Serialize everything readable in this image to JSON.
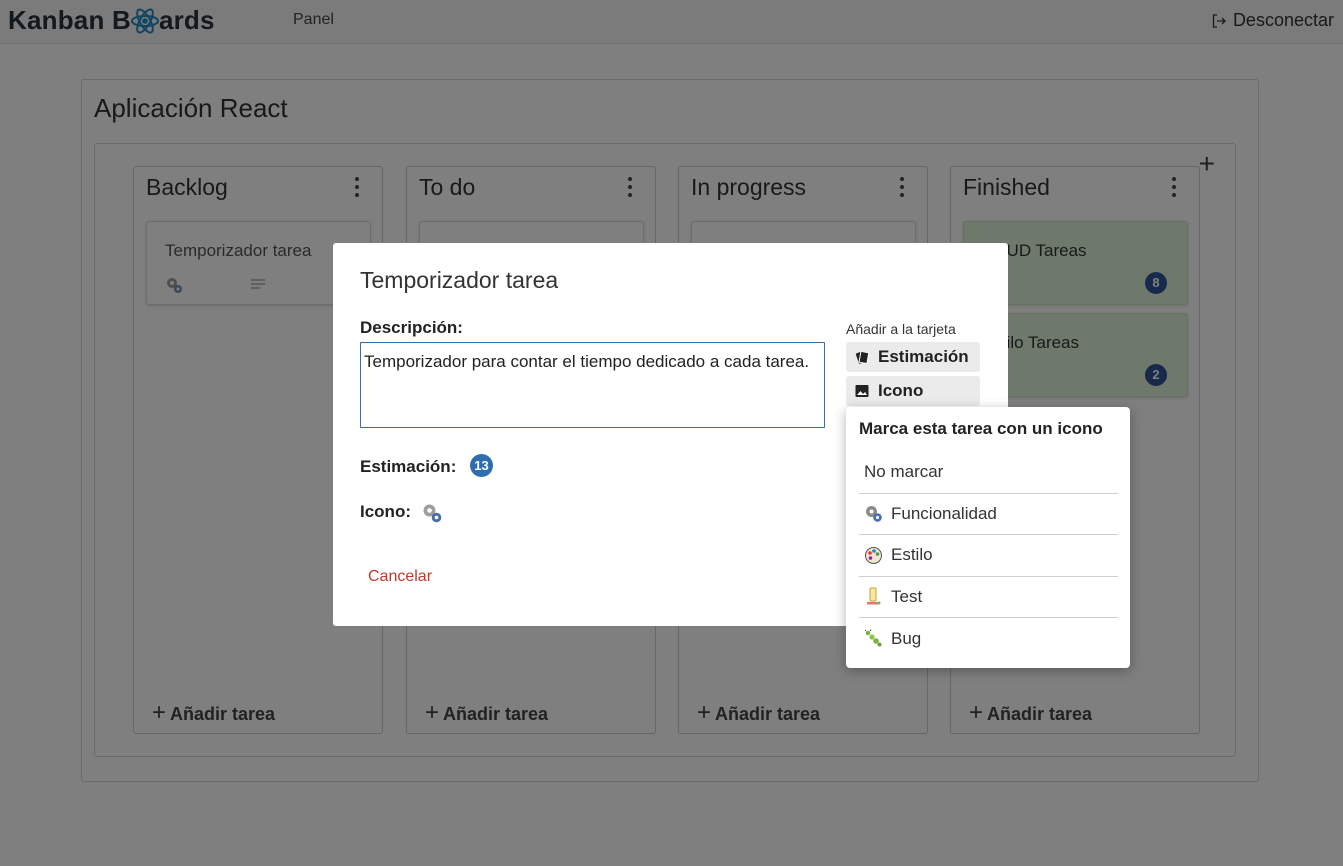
{
  "navbar": {
    "brand_left": "Kanban B",
    "brand_right": "ards",
    "panel_link": "Panel",
    "logout_label": "Desconectar"
  },
  "project": {
    "title": "Aplicación React",
    "add_column_label": "+"
  },
  "columns": [
    {
      "title": "Backlog",
      "add_task_label": "Añadir tarea",
      "cards": [
        {
          "title": "Temporizador tarea"
        }
      ]
    },
    {
      "title": "To do",
      "add_task_label": "Añadir tarea",
      "cards": [
        {
          "title": ""
        }
      ]
    },
    {
      "title": "In progress",
      "add_task_label": "Añadir tarea",
      "cards": [
        {
          "title": ""
        }
      ]
    },
    {
      "title": "Finished",
      "add_task_label": "Añadir tarea",
      "cards": [
        {
          "title": "CRUD Tareas",
          "estimate": "8"
        },
        {
          "title": "Estilo Tareas",
          "estimate": "2"
        }
      ]
    }
  ],
  "modal": {
    "title": "Temporizador tarea",
    "description_label": "Descripción:",
    "description_value": "Temporizador para contar el tiempo dedicado a cada tarea.",
    "estimate_label": "Estimación:",
    "estimate_value": "13",
    "icon_label": "Icono:",
    "icon_value": "gears-icon",
    "cancel_label": "Cancelar",
    "add_to_card_label": "Añadir a la tarjeta",
    "estimate_button": "Estimación",
    "icon_button": "Icono"
  },
  "icon_dropdown": {
    "title": "Marca esta tarea con un icono",
    "options": [
      {
        "label": "No marcar",
        "icon": ""
      },
      {
        "label": "Funcionalidad",
        "icon": "gears-icon"
      },
      {
        "label": "Estilo",
        "icon": "palette-icon"
      },
      {
        "label": "Test",
        "icon": "test-tube-icon"
      },
      {
        "label": "Bug",
        "icon": "bug-icon"
      }
    ]
  },
  "colors": {
    "badge_blue": "#2f5597",
    "estimate_blue": "#2f6db0",
    "finished_card_green": "#ddf2d8",
    "cancel_red": "#c0392b"
  }
}
